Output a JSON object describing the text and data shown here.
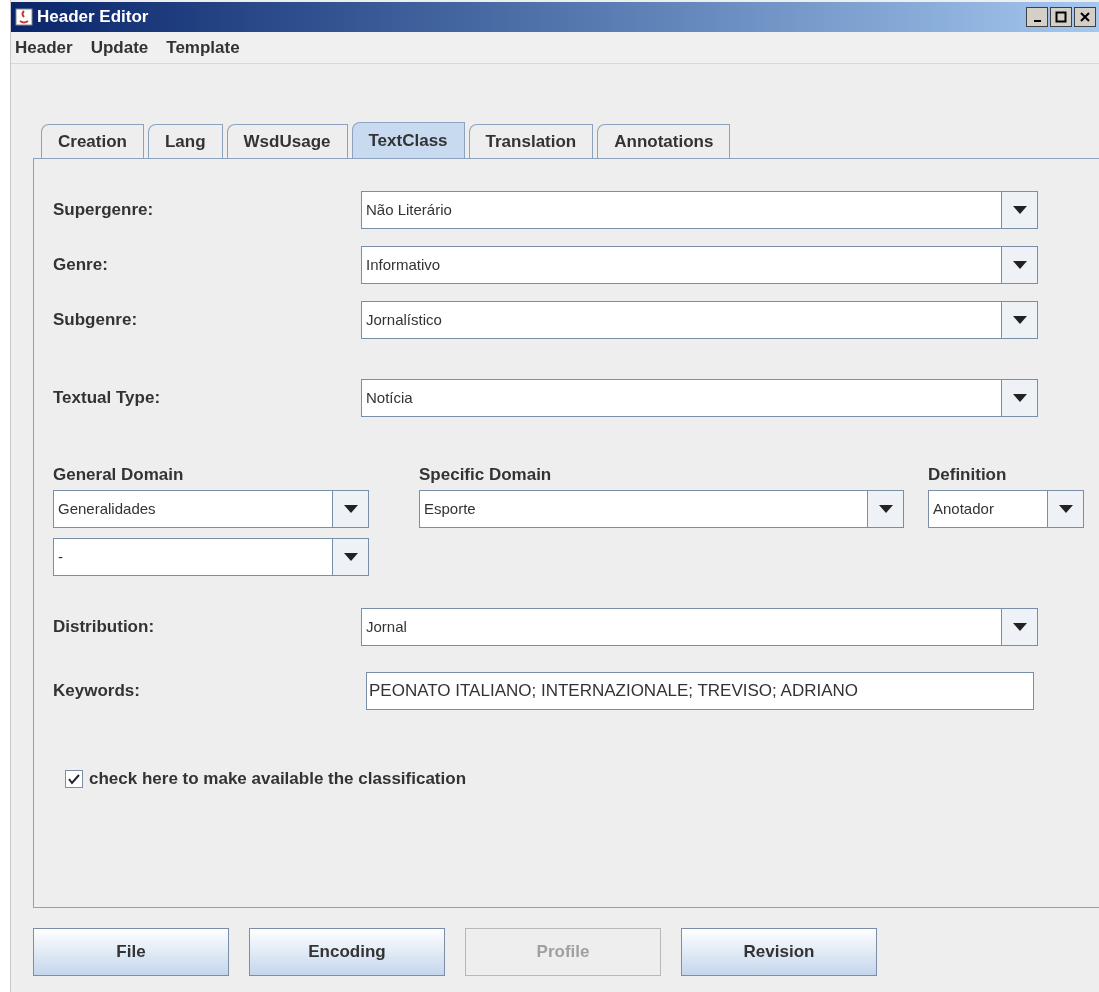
{
  "window": {
    "title": "Header Editor"
  },
  "menu": [
    "Header",
    "Update",
    "Template"
  ],
  "tabs": [
    {
      "label": "Creation",
      "selected": false
    },
    {
      "label": "Lang",
      "selected": false
    },
    {
      "label": "WsdUsage",
      "selected": false
    },
    {
      "label": "TextClass",
      "selected": true
    },
    {
      "label": "Translation",
      "selected": false
    },
    {
      "label": "Annotations",
      "selected": false
    }
  ],
  "fields_top": [
    {
      "label": "Supergenre:",
      "value": "Não Literário",
      "kind": "combo"
    },
    {
      "label": "Genre:",
      "value": "Informativo",
      "kind": "combo"
    },
    {
      "label": "Subgenre:",
      "value": "Jornalístico",
      "kind": "combo"
    },
    {
      "label": "Textual Type:",
      "value": "Notícia",
      "kind": "combo"
    }
  ],
  "domains": {
    "general": {
      "label": "General Domain",
      "values": [
        "Generalidades",
        "-"
      ]
    },
    "specific": {
      "label": "Specific Domain",
      "value": "Esporte"
    },
    "definition": {
      "label": "Definition",
      "value": "Anotador"
    }
  },
  "fields_bottom": [
    {
      "label": "Distribution:",
      "value": "Jornal",
      "kind": "combo"
    },
    {
      "label": "Keywords:",
      "value": "PEONATO ITALIANO; INTERNAZIONALE; TREVISO; ADRIANO",
      "kind": "text"
    }
  ],
  "checkbox": {
    "label": "check here to make available the classification",
    "checked": true
  },
  "buttons": [
    {
      "label": "File",
      "disabled": false
    },
    {
      "label": "Encoding",
      "disabled": false
    },
    {
      "label": "Profile",
      "disabled": true
    },
    {
      "label": "Revision",
      "disabled": false
    }
  ]
}
